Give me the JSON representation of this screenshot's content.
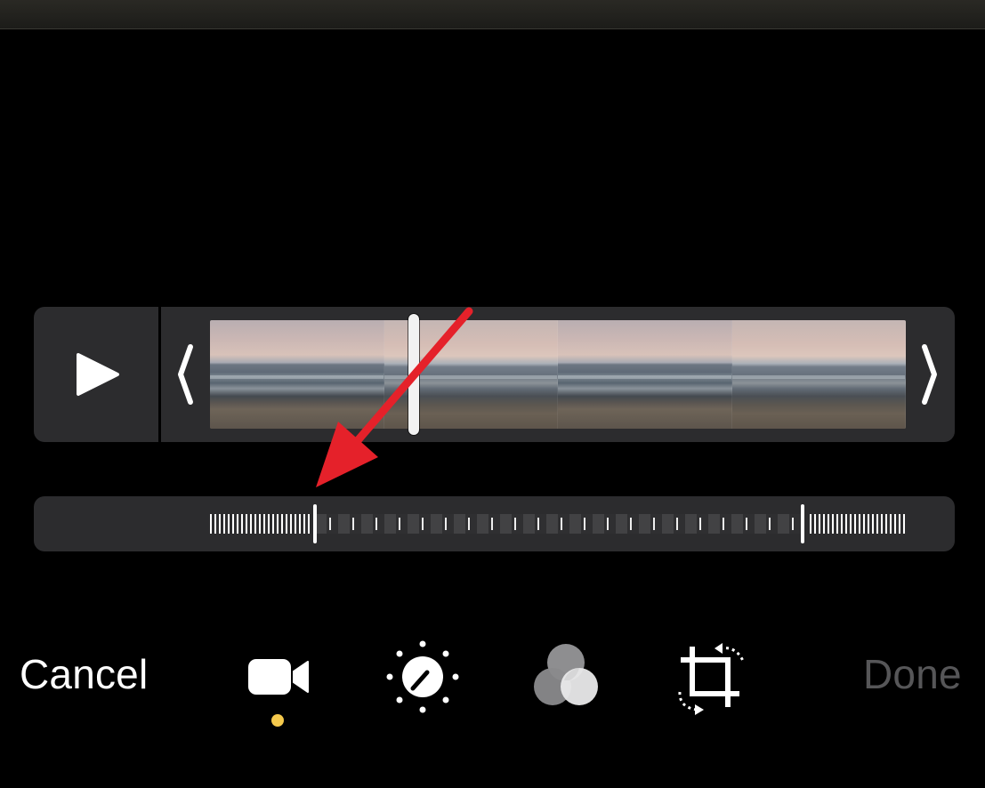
{
  "editor": {
    "cancel_label": "Cancel",
    "done_label": "Done",
    "active_tool": "video",
    "colors": {
      "background": "#000000",
      "panel": "#2c2c2e",
      "active_indicator": "#f5c94c",
      "done_disabled": "#565658",
      "annotation_arrow": "#e5212a"
    }
  },
  "timeline": {
    "play_icon": "play-icon",
    "left_trim_icon": "trim-left-handle",
    "right_trim_icon": "trim-right-handle",
    "frame_count": 4,
    "playhead_icon": "playhead"
  },
  "speed_control": {
    "slow_motion_start_fraction": 0.15,
    "slow_motion_end_fraction": 0.85
  },
  "toolbar": {
    "tools": [
      {
        "id": "video",
        "icon": "video-camera-icon"
      },
      {
        "id": "adjust",
        "icon": "adjust-dial-icon"
      },
      {
        "id": "filters",
        "icon": "filters-circles-icon"
      },
      {
        "id": "crop",
        "icon": "crop-rotate-icon"
      }
    ]
  }
}
